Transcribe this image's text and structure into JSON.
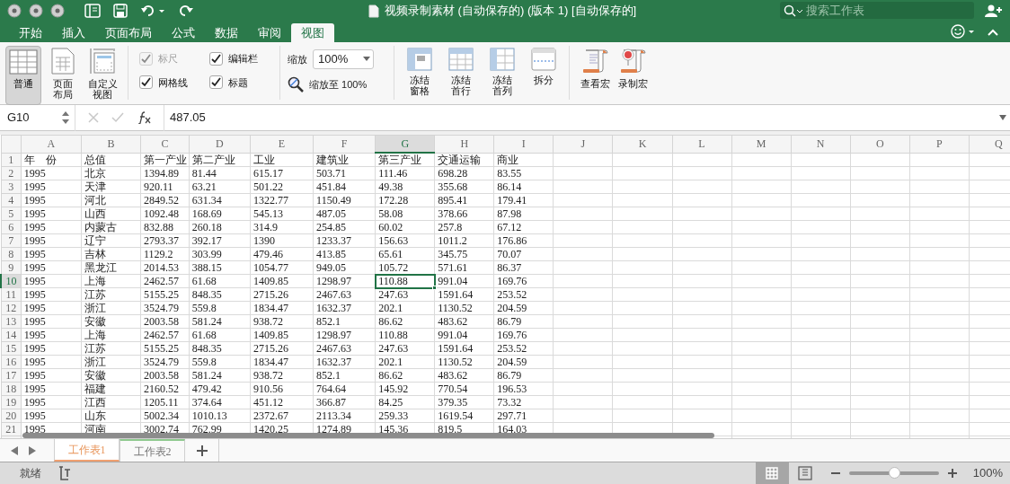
{
  "window": {
    "title": "视频录制素材 (自动保存的) (版本 1) [自动保存的]",
    "search_placeholder": "搜索工作表"
  },
  "tabs": [
    {
      "label": "开始",
      "selected": false
    },
    {
      "label": "插入",
      "selected": false
    },
    {
      "label": "页面布局",
      "selected": false
    },
    {
      "label": "公式",
      "selected": false
    },
    {
      "label": "数据",
      "selected": false
    },
    {
      "label": "审阅",
      "selected": false
    },
    {
      "label": "视图",
      "selected": true
    }
  ],
  "ribbon": {
    "views": [
      {
        "kind": "normal",
        "label": [
          "普通"
        ],
        "selected": true
      },
      {
        "kind": "page",
        "label": [
          "页面",
          "布局"
        ],
        "selected": false
      },
      {
        "kind": "custom",
        "label": [
          "自定义",
          "视图"
        ],
        "selected": false
      }
    ],
    "show": [
      {
        "label": "标尺",
        "checked": true,
        "disabled": true
      },
      {
        "label": "编辑栏",
        "checked": true,
        "disabled": false
      },
      {
        "label": "网格线",
        "checked": true,
        "disabled": false
      },
      {
        "label": "标题",
        "checked": true,
        "disabled": false
      }
    ],
    "zoom_label": "缩放",
    "zoom_value": "100%",
    "zoom_to": "缩放至 100%",
    "window_buttons": [
      {
        "kind": "freeze",
        "label": [
          "冻结",
          "窗格"
        ]
      },
      {
        "kind": "freeze_row",
        "label": [
          "冻结",
          "首行"
        ]
      },
      {
        "kind": "freeze_col",
        "label": [
          "冻结",
          "首列"
        ]
      },
      {
        "kind": "split",
        "label": [
          "拆分"
        ]
      }
    ],
    "macros": [
      {
        "kind": "view",
        "label": [
          "查看宏"
        ]
      },
      {
        "kind": "record",
        "label": [
          "录制宏"
        ]
      }
    ]
  },
  "formula_bar": {
    "name_box": "G10",
    "formula": "487.05"
  },
  "sheet": {
    "columns": [
      {
        "label": "A",
        "selected": false
      },
      {
        "label": "B",
        "selected": false
      },
      {
        "label": "C",
        "selected": false
      },
      {
        "label": "D",
        "selected": false
      },
      {
        "label": "E",
        "selected": false
      },
      {
        "label": "F",
        "selected": false
      },
      {
        "label": "G",
        "selected": true
      },
      {
        "label": "H",
        "selected": false
      },
      {
        "label": "I",
        "selected": false
      },
      {
        "label": "J",
        "selected": false
      },
      {
        "label": "K",
        "selected": false
      },
      {
        "label": "L",
        "selected": false
      },
      {
        "label": "M",
        "selected": false
      },
      {
        "label": "N",
        "selected": false
      },
      {
        "label": "O",
        "selected": false
      },
      {
        "label": "P",
        "selected": false
      },
      {
        "label": "Q",
        "selected": false
      }
    ],
    "rows": [
      {
        "number": "1",
        "selected": false,
        "cells": [
          "年　份",
          "总值",
          "第一产业",
          "第二产业",
          "工业",
          "建筑业",
          "第三产业",
          "交通运输",
          "商业"
        ]
      },
      {
        "number": "2",
        "selected": false,
        "cells": [
          "1995",
          "北京",
          "1394.89",
          "81.44",
          "615.17",
          "503.71",
          "111.46",
          "698.28",
          "83.55"
        ]
      },
      {
        "number": "3",
        "selected": false,
        "cells": [
          "1995",
          "天津",
          "920.11",
          "63.21",
          "501.22",
          "451.84",
          "49.38",
          "355.68",
          "86.14"
        ]
      },
      {
        "number": "4",
        "selected": false,
        "cells": [
          "1995",
          "河北",
          "2849.52",
          "631.34",
          "1322.77",
          "1150.49",
          "172.28",
          "895.41",
          "179.41"
        ]
      },
      {
        "number": "5",
        "selected": false,
        "cells": [
          "1995",
          "山西",
          "1092.48",
          "168.69",
          "545.13",
          "487.05",
          "58.08",
          "378.66",
          "87.98"
        ]
      },
      {
        "number": "6",
        "selected": false,
        "cells": [
          "1995",
          "内蒙古",
          "832.88",
          "260.18",
          "314.9",
          "254.85",
          "60.02",
          "257.8",
          "67.12"
        ]
      },
      {
        "number": "7",
        "selected": false,
        "cells": [
          "1995",
          "辽宁",
          "2793.37",
          "392.17",
          "1390",
          "1233.37",
          "156.63",
          "1011.2",
          "176.86"
        ]
      },
      {
        "number": "8",
        "selected": false,
        "cells": [
          "1995",
          "吉林",
          "1129.2",
          "303.99",
          "479.46",
          "413.85",
          "65.61",
          "345.75",
          "70.07"
        ]
      },
      {
        "number": "9",
        "selected": false,
        "cells": [
          "1995",
          "黑龙江",
          "2014.53",
          "388.15",
          "1054.77",
          "949.05",
          "105.72",
          "571.61",
          "86.37"
        ]
      },
      {
        "number": "10",
        "selected": true,
        "cells": [
          "1995",
          "上海",
          "2462.57",
          "61.68",
          "1409.85",
          "1298.97",
          "110.88",
          "991.04",
          "169.76"
        ]
      },
      {
        "number": "11",
        "selected": false,
        "cells": [
          "1995",
          "江苏",
          "5155.25",
          "848.35",
          "2715.26",
          "2467.63",
          "247.63",
          "1591.64",
          "253.52"
        ]
      },
      {
        "number": "12",
        "selected": false,
        "cells": [
          "1995",
          "浙江",
          "3524.79",
          "559.8",
          "1834.47",
          "1632.37",
          "202.1",
          "1130.52",
          "204.59"
        ]
      },
      {
        "number": "13",
        "selected": false,
        "cells": [
          "1995",
          "安徽",
          "2003.58",
          "581.24",
          "938.72",
          "852.1",
          "86.62",
          "483.62",
          "86.79"
        ]
      },
      {
        "number": "14",
        "selected": false,
        "cells": [
          "1995",
          "上海",
          "2462.57",
          "61.68",
          "1409.85",
          "1298.97",
          "110.88",
          "991.04",
          "169.76"
        ]
      },
      {
        "number": "15",
        "selected": false,
        "cells": [
          "1995",
          "江苏",
          "5155.25",
          "848.35",
          "2715.26",
          "2467.63",
          "247.63",
          "1591.64",
          "253.52"
        ]
      },
      {
        "number": "16",
        "selected": false,
        "cells": [
          "1995",
          "浙江",
          "3524.79",
          "559.8",
          "1834.47",
          "1632.37",
          "202.1",
          "1130.52",
          "204.59"
        ]
      },
      {
        "number": "17",
        "selected": false,
        "cells": [
          "1995",
          "安徽",
          "2003.58",
          "581.24",
          "938.72",
          "852.1",
          "86.62",
          "483.62",
          "86.79"
        ]
      },
      {
        "number": "18",
        "selected": false,
        "cells": [
          "1995",
          "福建",
          "2160.52",
          "479.42",
          "910.56",
          "764.64",
          "145.92",
          "770.54",
          "196.53"
        ]
      },
      {
        "number": "19",
        "selected": false,
        "cells": [
          "1995",
          "江西",
          "1205.11",
          "374.64",
          "451.12",
          "366.87",
          "84.25",
          "379.35",
          "73.32"
        ]
      },
      {
        "number": "20",
        "selected": false,
        "cells": [
          "1995",
          "山东",
          "5002.34",
          "1010.13",
          "2372.67",
          "2113.34",
          "259.33",
          "1619.54",
          "297.71"
        ]
      },
      {
        "number": "21",
        "selected": false,
        "cells": [
          "1995",
          "河南",
          "3002.74",
          "762.99",
          "1420.25",
          "1274.89",
          "145.36",
          "819.5",
          "164.03"
        ]
      }
    ]
  },
  "sheet_tabs": [
    {
      "label": "工作表1",
      "selected": true
    },
    {
      "label": "工作表2",
      "selected": false
    }
  ],
  "status_bar": {
    "text": "就绪",
    "views": [
      {
        "kind": "normal",
        "selected": true
      },
      {
        "kind": "page",
        "selected": false
      }
    ],
    "zoom_slider": {
      "level": 0.5
    },
    "zoom": "100%"
  }
}
